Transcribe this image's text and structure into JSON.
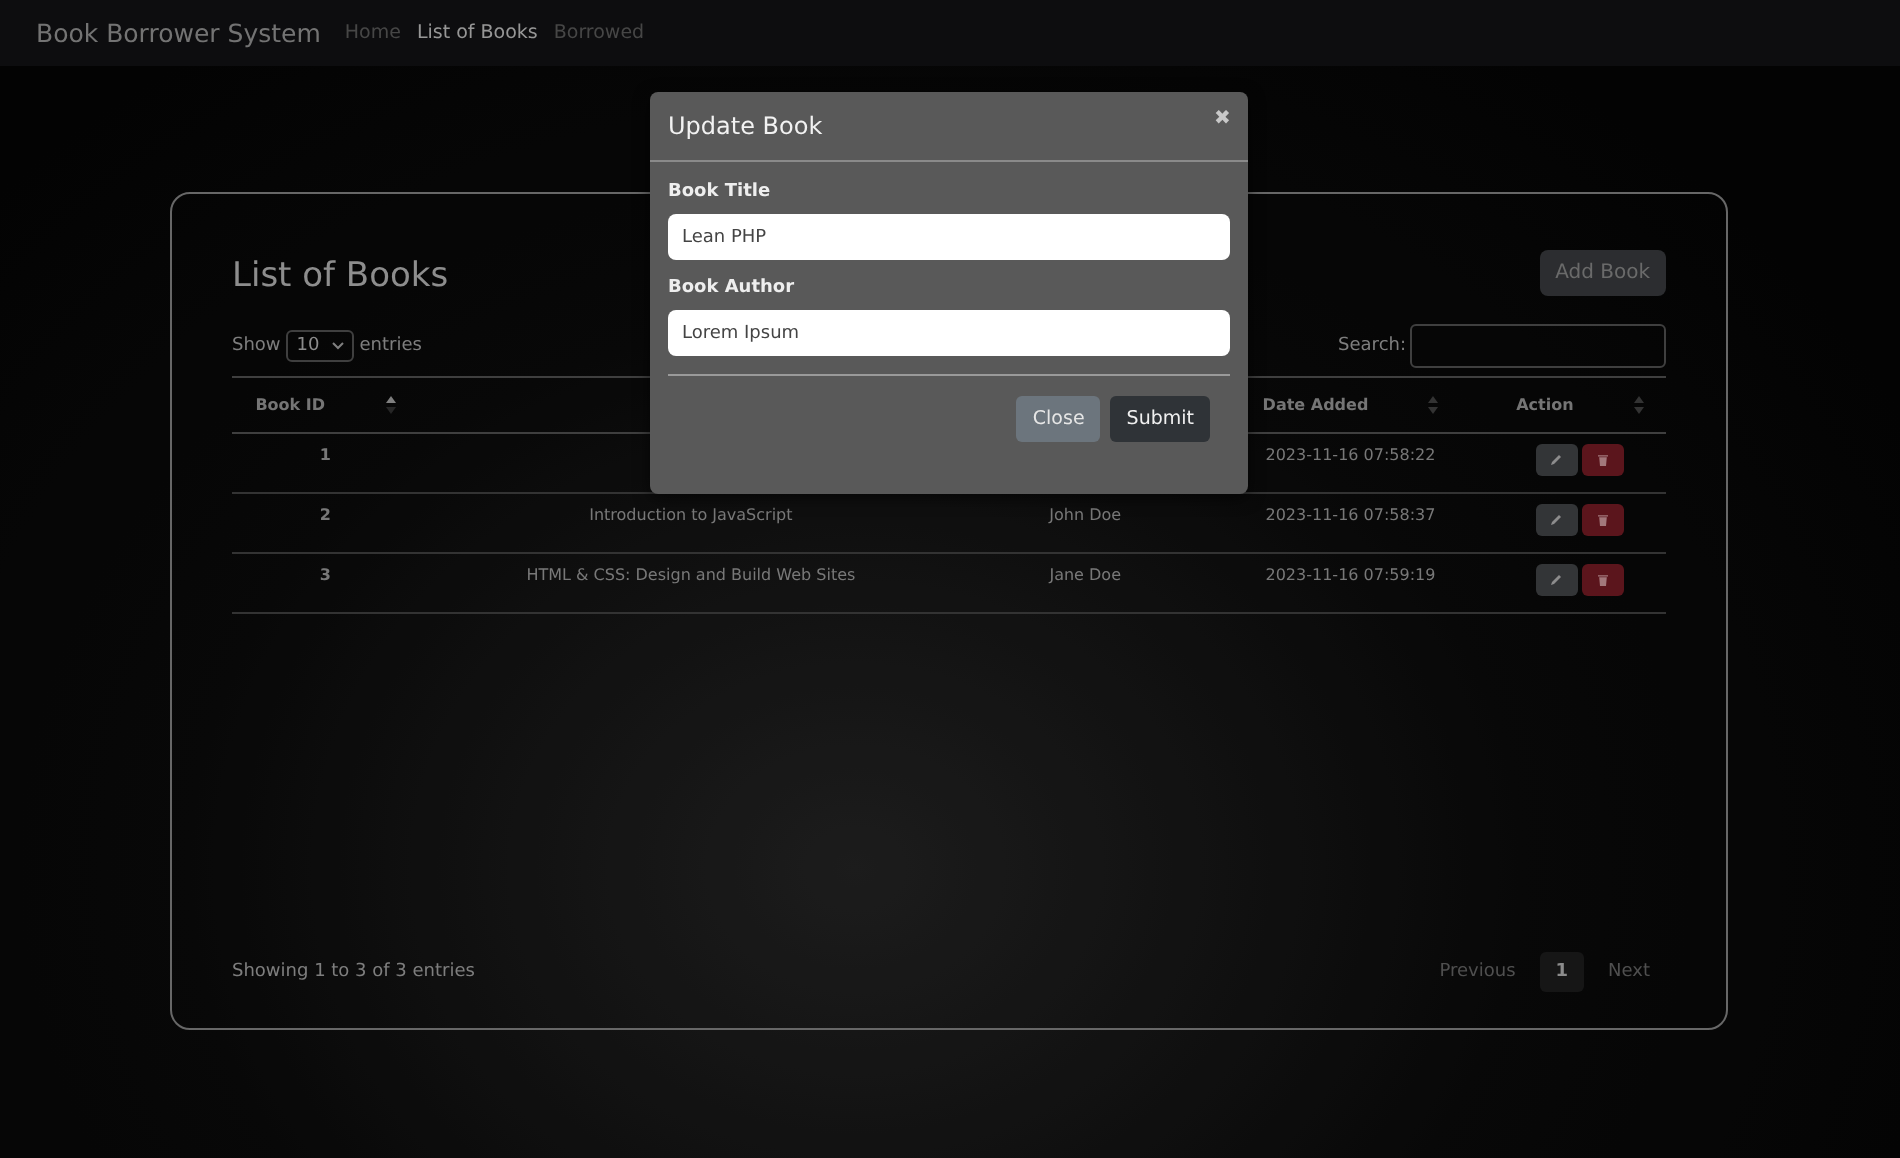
{
  "navbar": {
    "brand": "Book Borrower System",
    "links": [
      {
        "label": "Home",
        "selected": false
      },
      {
        "label": "List of Books",
        "selected": true
      },
      {
        "label": "Borrowed",
        "selected": false
      }
    ]
  },
  "card": {
    "title": "List of Books",
    "add_button": "Add Book",
    "length": {
      "before": "Show",
      "value": "10",
      "after": "entries"
    },
    "search": {
      "label": "Search:"
    },
    "table": {
      "columns": [
        {
          "label": "Book ID",
          "sorted": true
        },
        {},
        {},
        {
          "label": "Date Added",
          "sorted": false
        },
        {
          "label": "Action",
          "sorted": false
        }
      ],
      "rows": [
        {
          "id": "1",
          "date": "2023-11-16 07:58:22"
        },
        {
          "id": "2",
          "title": "Introduction to JavaScript",
          "author": "John Doe",
          "date": "2023-11-16 07:58:37"
        },
        {
          "id": "3",
          "title": "HTML & CSS: Design and Build Web Sites",
          "author": "Jane Doe",
          "date": "2023-11-16 07:59:19"
        }
      ]
    },
    "info": "Showing 1 to 3 of 3 entries",
    "pagination": [
      {
        "label": "Previous",
        "kind": "nav",
        "disabled": true
      },
      {
        "label": "1",
        "kind": "page",
        "selected": true
      },
      {
        "label": "Next",
        "kind": "nav",
        "disabled": true
      }
    ]
  },
  "modal": {
    "title": "Update Book",
    "close_icon": "✖",
    "fields": [
      {
        "label": "Book Title",
        "value": "Lean PHP"
      },
      {
        "label": "Book Author",
        "value": "Lorem Ipsum"
      }
    ],
    "buttons": [
      {
        "label": "Close",
        "kind": "secondary"
      },
      {
        "label": "Submit",
        "kind": "dark"
      }
    ]
  }
}
